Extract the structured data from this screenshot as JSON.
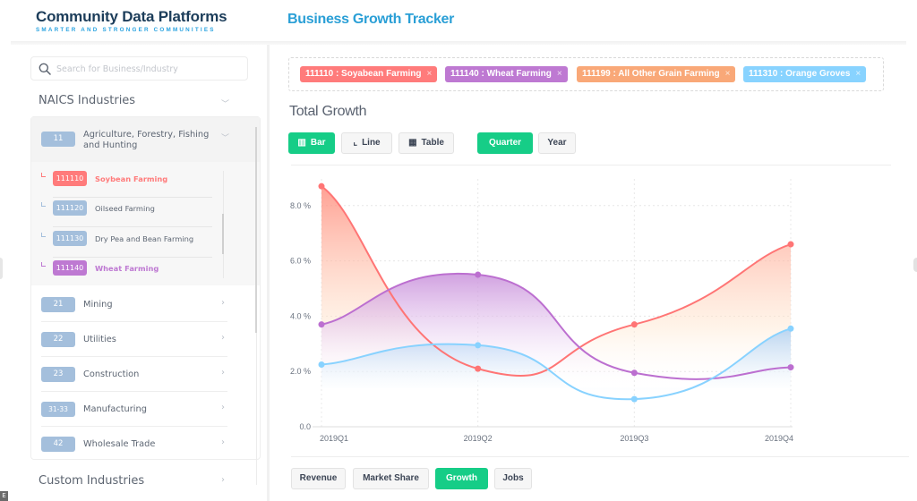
{
  "brand": {
    "title": "Community Data Platforms",
    "subtitle": "SMARTER AND STRONGER COMMUNITIES"
  },
  "page_title": "Business Growth Tracker",
  "sidebar": {
    "search_placeholder": "Search for Business/Industry",
    "search_icon": "search-icon",
    "naics_title": "NAICS Industries",
    "custom_title": "Custom Industries",
    "open_group": {
      "code": "11",
      "label": "Agriculture, Forestry, Fishing and Hunting",
      "children": [
        {
          "code": "111110",
          "label": "Soybean Farming",
          "selected": true,
          "color": "#ff7b7b"
        },
        {
          "code": "111120",
          "label": "Oilseed Farming",
          "selected": false,
          "color": "#a4bfdc"
        },
        {
          "code": "111130",
          "label": "Dry Pea and Bean Farming",
          "selected": false,
          "color": "#a4bfdc"
        },
        {
          "code": "111140",
          "label": "Wheat Farming",
          "selected": true,
          "color": "#be79d2"
        }
      ]
    },
    "groups": [
      {
        "code": "21",
        "label": "Mining"
      },
      {
        "code": "22",
        "label": "Utilities"
      },
      {
        "code": "23",
        "label": "Construction"
      },
      {
        "code": "31-33",
        "label": "Manufacturing"
      },
      {
        "code": "42",
        "label": "Wholesale Trade"
      }
    ]
  },
  "chips": [
    {
      "label": "111110 : Soyabean Farming",
      "color": "#ff7b7b"
    },
    {
      "label": "111140 : Wheat Farming",
      "color": "#be79d2"
    },
    {
      "label": "111199 : All Other Grain Farming",
      "color": "#f9a878"
    },
    {
      "label": "111310 : Orange Groves",
      "color": "#88d3ff"
    }
  ],
  "chip_close": "×",
  "chart_title": "Total Growth",
  "chart_type_buttons": [
    {
      "label": "Bar",
      "icon": "bar-chart-icon",
      "glyph": "▥",
      "active": true
    },
    {
      "label": "Line",
      "icon": "line-chart-icon",
      "glyph": "⌞",
      "active": false
    },
    {
      "label": "Table",
      "icon": "table-icon",
      "glyph": "▦",
      "active": false
    }
  ],
  "period_buttons": [
    {
      "label": "Quarter",
      "active": true
    },
    {
      "label": "Year",
      "active": false
    }
  ],
  "metric_tabs": [
    {
      "label": "Revenue",
      "active": false
    },
    {
      "label": "Market Share",
      "active": false
    },
    {
      "label": "Growth",
      "active": true
    },
    {
      "label": "Jobs",
      "active": false
    }
  ],
  "chart_data": {
    "type": "area",
    "title": "Total Growth",
    "xlabel": "",
    "ylabel": "",
    "categories": [
      "2019Q1",
      "2019Q2",
      "2019Q3",
      "2019Q4"
    ],
    "y_ticks": [
      "0.0",
      "2.0 %",
      "4.0 %",
      "6.0 %",
      "8.0 %"
    ],
    "y_tick_values": [
      0,
      2,
      4,
      6,
      8
    ],
    "ylim": [
      0,
      9
    ],
    "grid": true,
    "smooth": true,
    "series": [
      {
        "name": "111110 : Soyabean Farming",
        "values": [
          8.7,
          2.1,
          3.7,
          6.6
        ],
        "color": "#ff7575",
        "fill_from": "#ff8a7a",
        "fill_to": "#ffe7cf"
      },
      {
        "name": "111140 : Wheat Farming",
        "values": [
          3.7,
          5.5,
          1.95,
          2.15
        ],
        "color": "#bc6fd0",
        "fill_from": "#c68bd9",
        "fill_to": "#f6eafa"
      },
      {
        "name": "111310 : Orange Groves",
        "values": [
          2.25,
          2.95,
          1.0,
          3.55
        ],
        "color": "#88d2ff",
        "fill_from": "#a9cdf2",
        "fill_to": "#eef6fd"
      }
    ]
  }
}
